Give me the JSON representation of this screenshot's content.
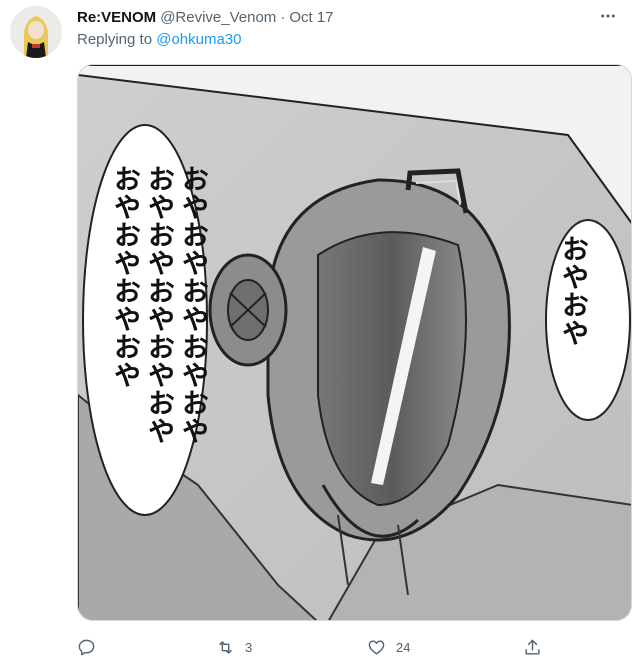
{
  "tweet": {
    "display_name": "Re:VENOM",
    "handle": "@Revive_Venom",
    "separator": "·",
    "date": "Oct 17",
    "replying_prefix": "Replying to",
    "replying_handle": "@ohkuma30"
  },
  "media": {
    "bubble_left_text": "おやおやおやおやおやおやおやおやおやおやおやおやおやおや",
    "bubble_right_text": "おやおや"
  },
  "actions": {
    "reply_count": "",
    "retweet_count": "3",
    "like_count": "24",
    "share_count": ""
  },
  "icons": {
    "more": "more-horizontal-icon",
    "reply": "reply-icon",
    "retweet": "retweet-icon",
    "like": "heart-icon",
    "share": "share-icon"
  },
  "colors": {
    "text_primary": "#0f1419",
    "text_secondary": "#536471",
    "link": "#1d9bf0"
  }
}
